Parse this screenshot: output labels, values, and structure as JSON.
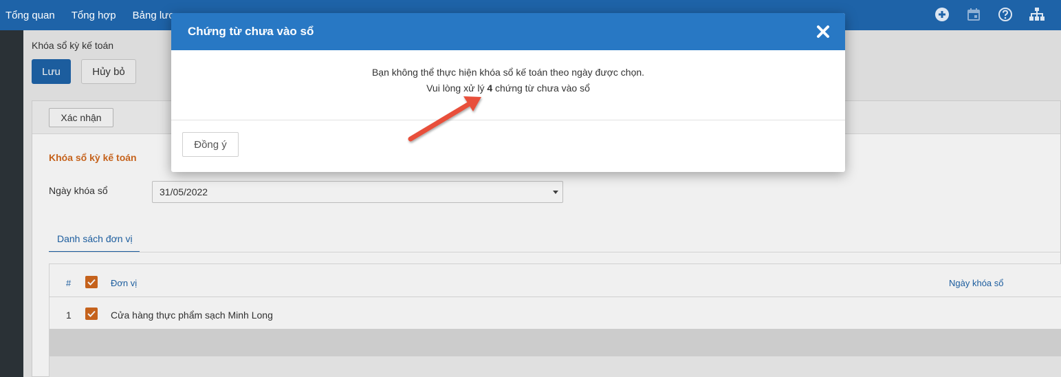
{
  "topnav": {
    "items": [
      "Tổng quan",
      "Tổng hợp",
      "Bảng lương"
    ]
  },
  "icons": [
    "plus-circle-icon",
    "calendar-icon",
    "help-icon",
    "org-chart-icon"
  ],
  "page": {
    "title": "Khóa sổ kỳ kế toán",
    "save_label": "Lưu",
    "cancel_label": "Hủy bỏ",
    "confirm_label": "Xác nhận",
    "section_title": "Khóa sổ kỳ kế toán",
    "date_label": "Ngày khóa sổ",
    "date_value": "31/05/2022",
    "tab_label": "Danh sách đơn vị"
  },
  "table": {
    "col_index": "#",
    "col_unit": "Đơn vị",
    "col_date": "Ngày khóa sổ",
    "rows": [
      {
        "index": "1",
        "unit": "Cửa hàng thực phẩm sạch Minh Long",
        "checked": true
      }
    ]
  },
  "modal": {
    "title": "Chứng từ chưa vào sổ",
    "message_line1": "Bạn không thể thực hiện khóa sổ kế toán theo ngày được chọn.",
    "message_line2_prefix": "Vui lòng xử lý ",
    "message_count": "4",
    "message_line2_suffix": " chứng từ chưa vào sổ",
    "ok_label": "Đồng ý"
  },
  "colors": {
    "topbar": "#1e63a8",
    "modal_header": "#2878c4",
    "accent_orange": "#d2691e",
    "arrow": "#e8503a"
  }
}
